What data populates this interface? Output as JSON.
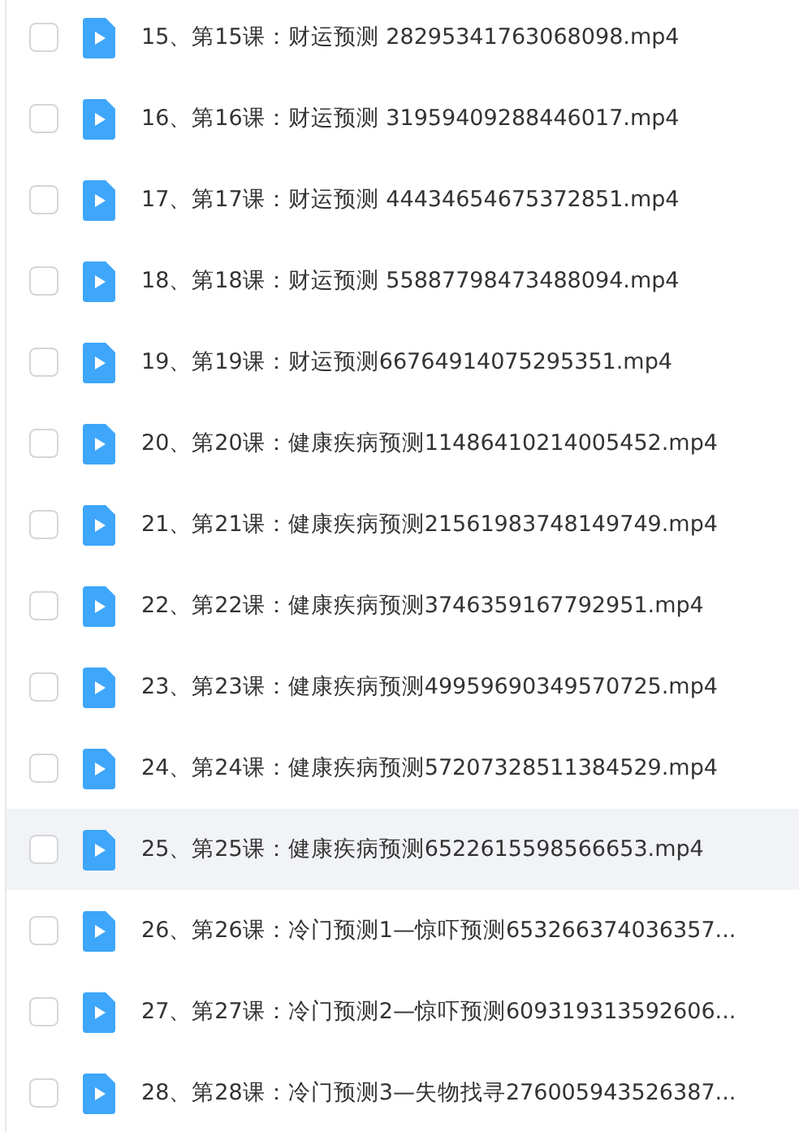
{
  "files": [
    {
      "name": "15、第15课：财运预测 28295341763068098.mp4",
      "checked": false,
      "highlighted": false
    },
    {
      "name": "16、第16课：财运预测 31959409288446017.mp4",
      "checked": false,
      "highlighted": false
    },
    {
      "name": "17、第17课：财运预测 44434654675372851.mp4",
      "checked": false,
      "highlighted": false
    },
    {
      "name": "18、第18课：财运预测 55887798473488094.mp4",
      "checked": false,
      "highlighted": false
    },
    {
      "name": "19、第19课：财运预测66764914075295351.mp4",
      "checked": false,
      "highlighted": false
    },
    {
      "name": "20、第20课：健康疾病预测11486410214005452.mp4",
      "checked": false,
      "highlighted": false
    },
    {
      "name": "21、第21课：健康疾病预测21561983748149749.mp4",
      "checked": false,
      "highlighted": false
    },
    {
      "name": "22、第22课：健康疾病预测3746359167792951.mp4",
      "checked": false,
      "highlighted": false
    },
    {
      "name": "23、第23课：健康疾病预测49959690349570725.mp4",
      "checked": false,
      "highlighted": false
    },
    {
      "name": "24、第24课：健康疾病预测57207328511384529.mp4",
      "checked": false,
      "highlighted": false
    },
    {
      "name": "25、第25课：健康疾病预测6522615598566653.mp4",
      "checked": false,
      "highlighted": true
    },
    {
      "name": "26、第26课：冷门预测1—惊吓预测653266374036357...",
      "checked": false,
      "highlighted": false
    },
    {
      "name": "27、第27课：冷门预测2—惊吓预测609319313592606...",
      "checked": false,
      "highlighted": false
    },
    {
      "name": "28、第28课：冷门预测3—失物找寻276005943526387...",
      "checked": false,
      "highlighted": false
    }
  ]
}
